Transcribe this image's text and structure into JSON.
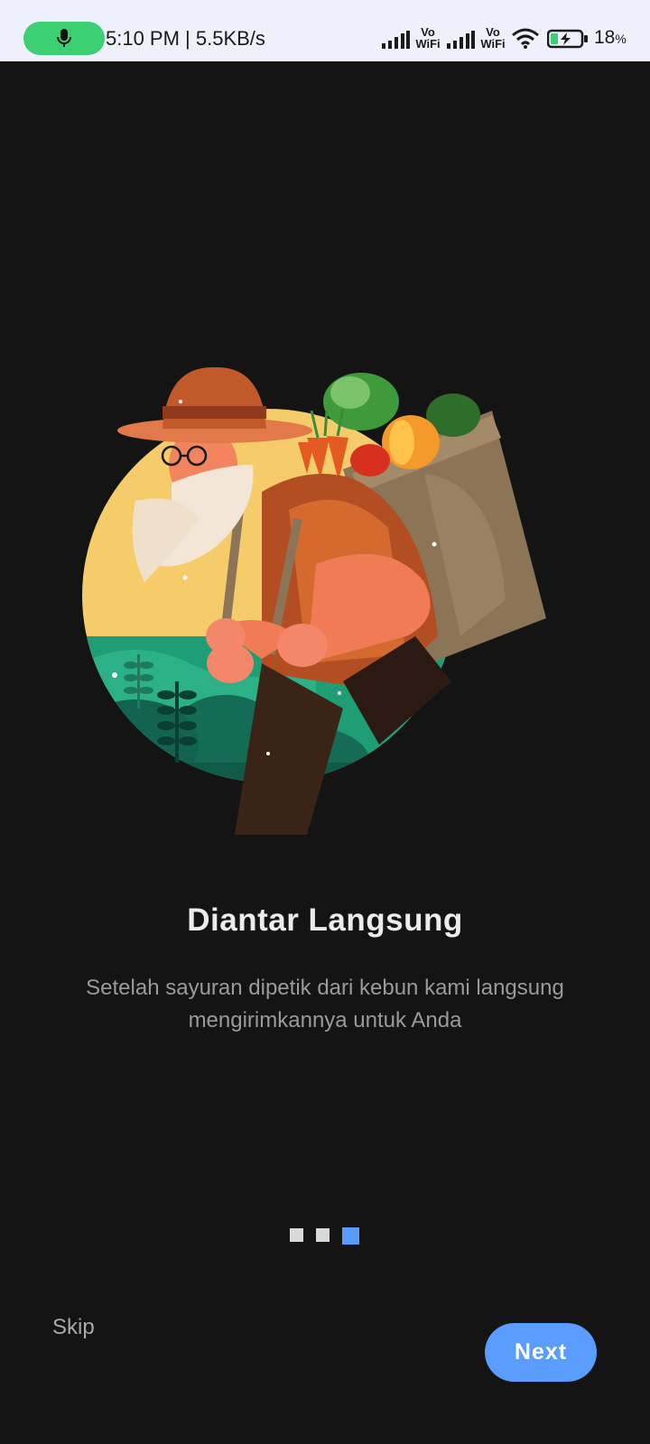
{
  "status_bar": {
    "time_speed": "5:10 PM | 5.5KB/s",
    "vowifi_1": "Vo WiFi",
    "vowifi_2": "Vo WiFi",
    "battery_percent": "18",
    "battery_unit": "%",
    "icons": [
      "mic-icon",
      "signal-icon",
      "signal-icon",
      "wifi-icon",
      "battery-charging-icon"
    ],
    "colors": {
      "background": "#eef1fb",
      "mic_pill": "#3ccf74"
    }
  },
  "onboarding": {
    "illustration": "farmer-carrying-vegetable-basket",
    "title": "Diantar Langsung",
    "description": "Setelah sayuran dipetik dari kebun kami langsung mengirimkannya untuk Anda",
    "pager": {
      "total": 3,
      "current": 3
    },
    "skip_label": "Skip",
    "next_label": "Next"
  },
  "colors": {
    "background": "#141414",
    "accent": "#5b9cff",
    "title": "#ececec",
    "description": "#9a9a9a"
  }
}
